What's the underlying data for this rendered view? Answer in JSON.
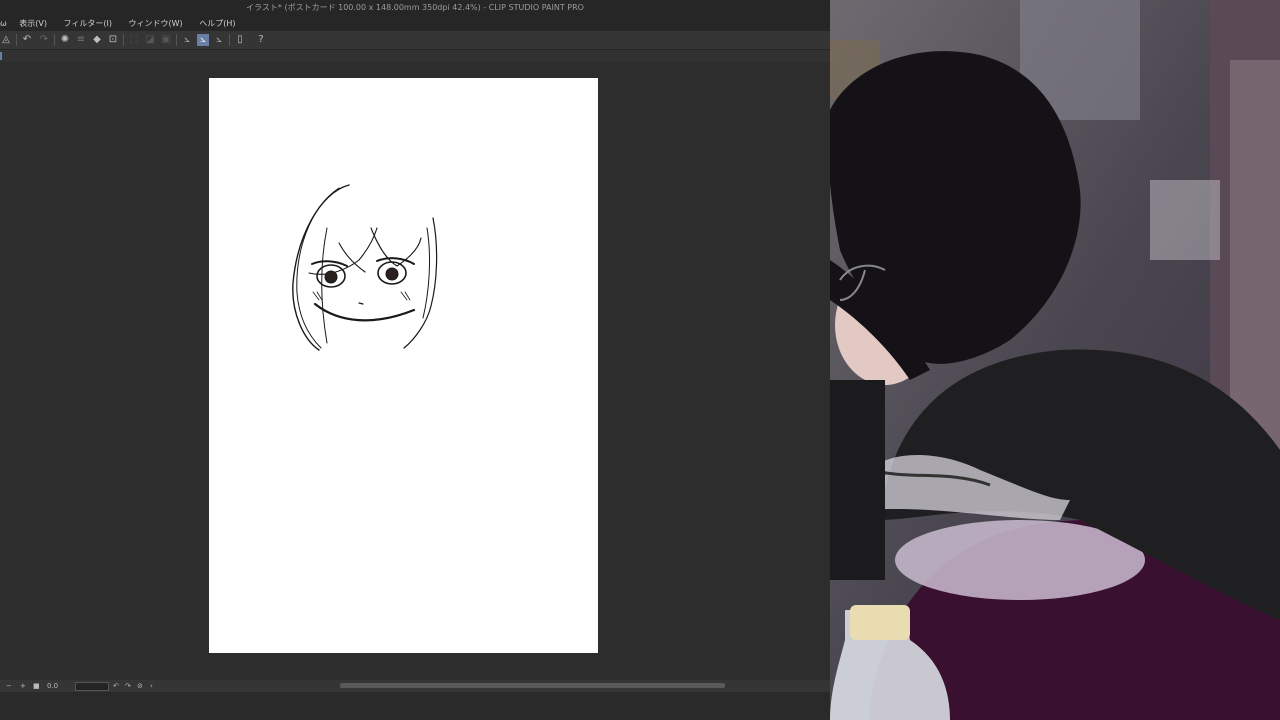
{
  "window": {
    "title": "イラスト* (ポストカード 100.00 x 148.00mm 350dpi 42.4%) - CLIP STUDIO PAINT PRO"
  },
  "menu": {
    "items": [
      "表示(V)",
      "フィルター(I)",
      "ウィンドウ(W)",
      "ヘルプ(H)"
    ]
  },
  "status": {
    "controls": [
      "−",
      "+",
      "■",
      "0.0",
      "↶",
      "↷",
      "⊘",
      "‹"
    ]
  }
}
